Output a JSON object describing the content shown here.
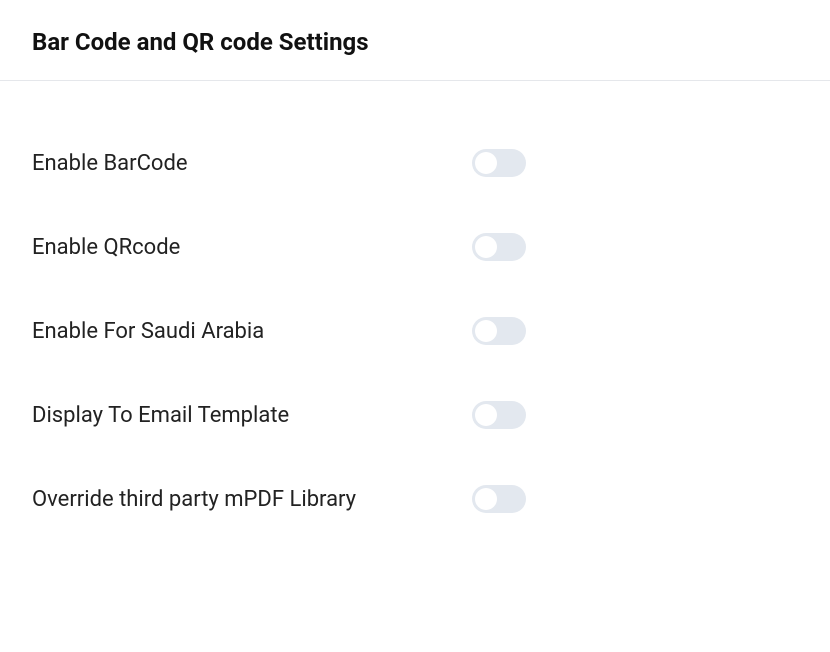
{
  "header": {
    "title": "Bar Code and QR code Settings"
  },
  "settings": [
    {
      "label": "Enable BarCode",
      "value": false
    },
    {
      "label": "Enable QRcode",
      "value": false
    },
    {
      "label": "Enable For Saudi Arabia",
      "value": false
    },
    {
      "label": "Display To Email Template",
      "value": false
    },
    {
      "label": "Override third party mPDF Library",
      "value": false
    }
  ]
}
